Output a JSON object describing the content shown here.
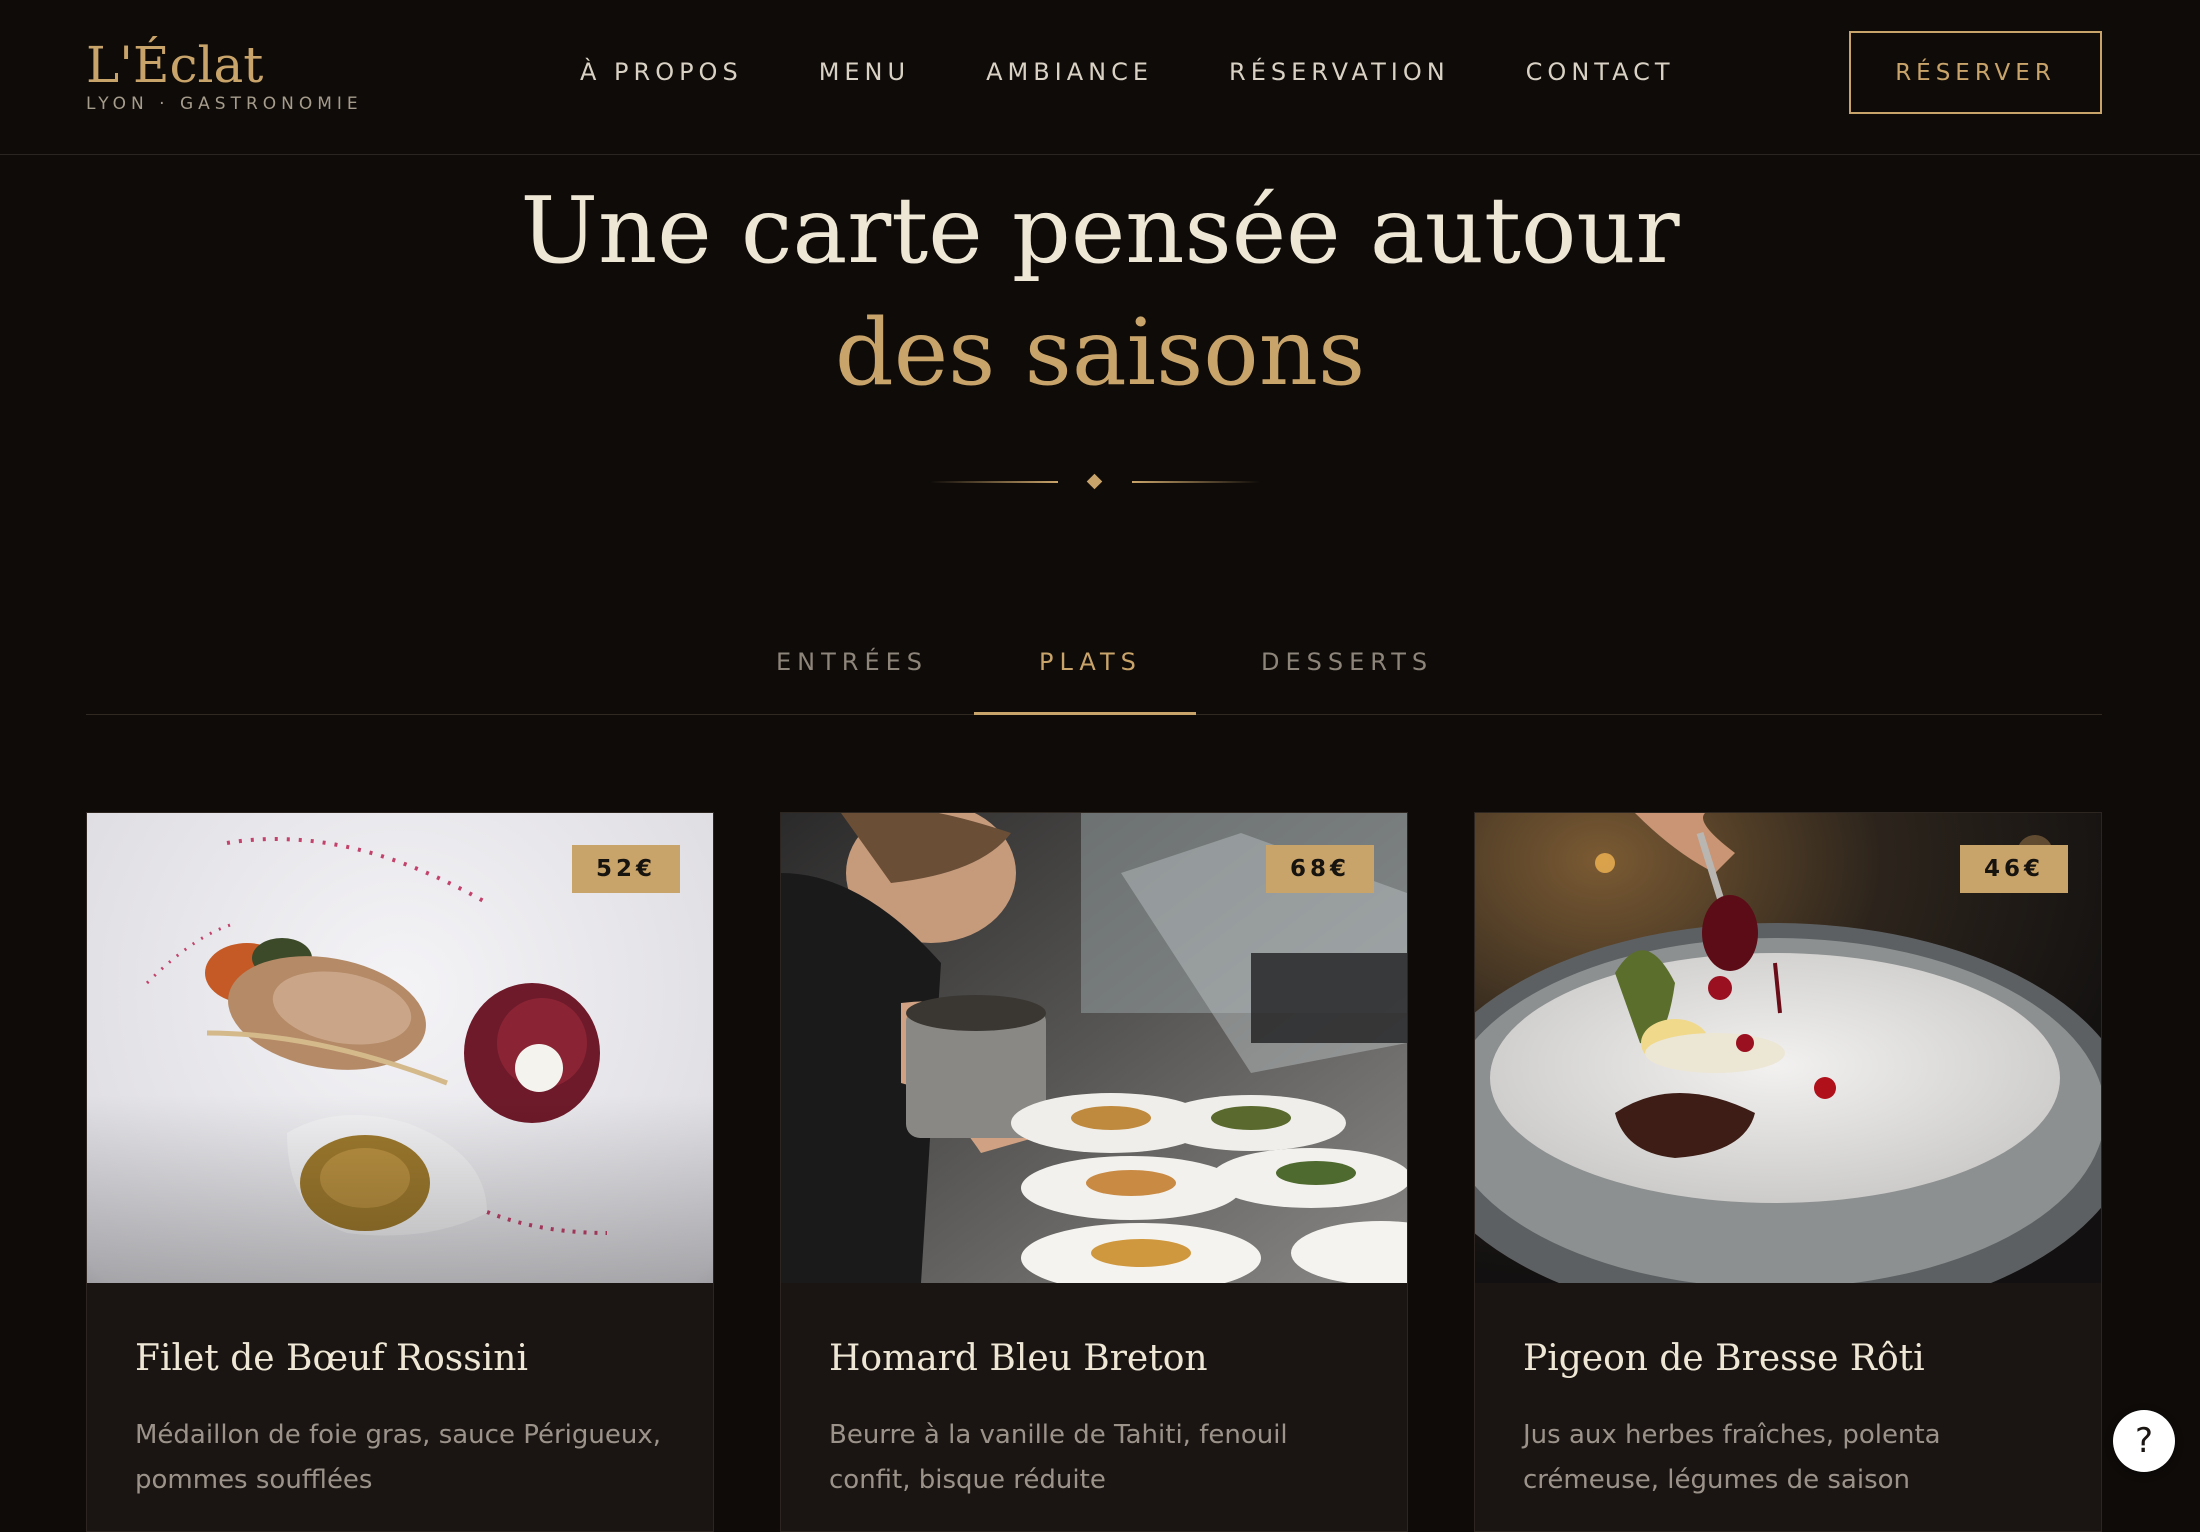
{
  "brand": {
    "title": "L'Éclat",
    "subtitle": "LYON · GASTRONOMIE"
  },
  "nav": {
    "items": [
      "À PROPOS",
      "MENU",
      "AMBIANCE",
      "RÉSERVATION",
      "CONTACT"
    ],
    "cta_label": "RÉSERVER"
  },
  "hero": {
    "line1": "Une carte pensée autour",
    "line2": "des saisons"
  },
  "tabs": {
    "items": [
      "ENTRÉES",
      "PLATS",
      "DESSERTS"
    ],
    "active": "PLATS"
  },
  "dishes": [
    {
      "title": "Filet de Bœuf Rossini",
      "price": "52€",
      "description": "Médaillon de foie gras, sauce Périgueux, pommes soufflées"
    },
    {
      "title": "Homard Bleu Breton",
      "price": "68€",
      "description": "Beurre à la vanille de Tahiti, fenouil confit, bisque réduite"
    },
    {
      "title": "Pigeon de Bresse Rôti",
      "price": "46€",
      "description": "Jus aux herbes fraîches, polenta crémeuse, légumes de saison"
    }
  ],
  "help": {
    "label": "?"
  },
  "colors": {
    "background": "#0e0b09",
    "accent_gold": "#c9a46a",
    "card_background": "#1a1512",
    "text_light": "#efe7d6",
    "text_muted": "#9b938a"
  }
}
